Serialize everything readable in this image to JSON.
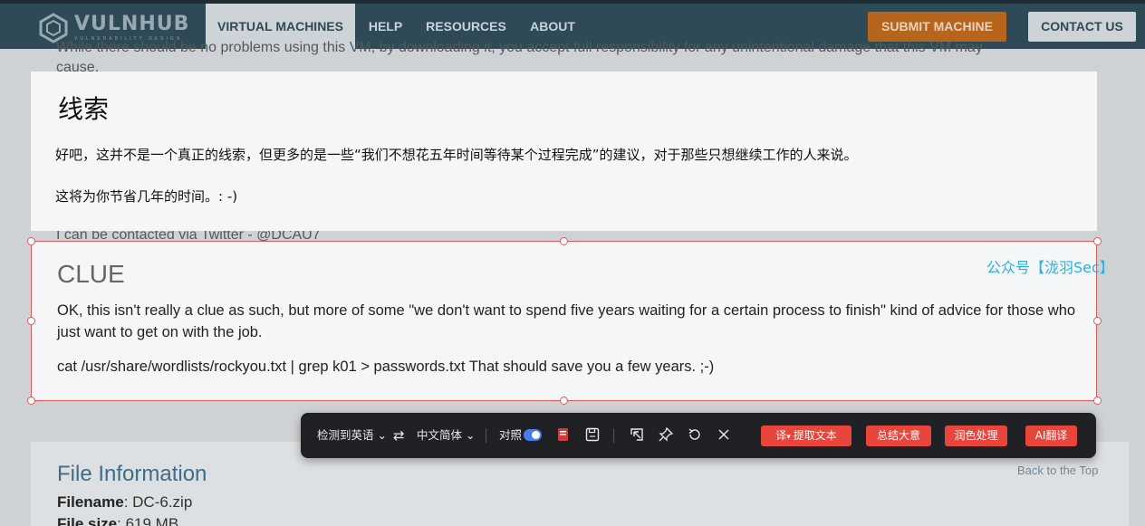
{
  "nav": {
    "logo_text": "VULNHUB",
    "logo_sub": "VULNERABILITY DESIGN",
    "links": [
      "VIRTUAL MACHINES",
      "HELP",
      "RESOURCES",
      "ABOUT"
    ],
    "submit": "SUBMIT MACHINE",
    "contact": "CONTACT US"
  },
  "background": {
    "line1": "While there should be no problems using this VM, by downloading it, you accept full responsibility for any unintentional damage that this VM may",
    "line2": "cause.",
    "twitter": "I can be contacted via Twitter - @DCAU7",
    "file_heading": "File Information",
    "filename_label": "Filename",
    "filename_value": ": DC-6.zip",
    "filesize_label": "File size",
    "filesize_value": ": 619 MB",
    "back_to_top": "Back to the Top"
  },
  "translation": {
    "title": "线索",
    "p1": "好吧，这并不是一个真正的线索，但更多的是一些“我们不想花五年时间等待某个过程完成”的建议，对于那些只想继续工作的人来说。",
    "p2": "这将为你节省几年的时间。: -)"
  },
  "original": {
    "title": "CLUE",
    "p1": "OK, this isn't really a clue as such, but more of some \"we don't want to spend five years waiting for a certain process to finish\" kind of advice for those who just want to get on with the job.",
    "p2": "cat /usr/share/wordlists/rockyou.txt | grep k01 > passwords.txt That should save you a few years. ;-)"
  },
  "watermark": "公众号【泷羽Sec】",
  "toolbar": {
    "source_lang": "检测到英语",
    "swap_icon": "swap-icon",
    "target_lang": "中文简体",
    "compare_label": "对照",
    "compare_on": true,
    "extract": "提取文本",
    "extract_prefix": "译",
    "summarize": "总结大意",
    "polish": "润色处理",
    "ai_translate": "AI翻译"
  },
  "colors": {
    "nav_bg": "#2f4a57",
    "accent_orange": "#b7651c",
    "selection_red": "#e25b5b",
    "toolbar_bg": "#202124",
    "action_red": "#e8463c",
    "toggle_blue": "#4a7cf0",
    "watermark_cyan": "#27b3e6"
  }
}
